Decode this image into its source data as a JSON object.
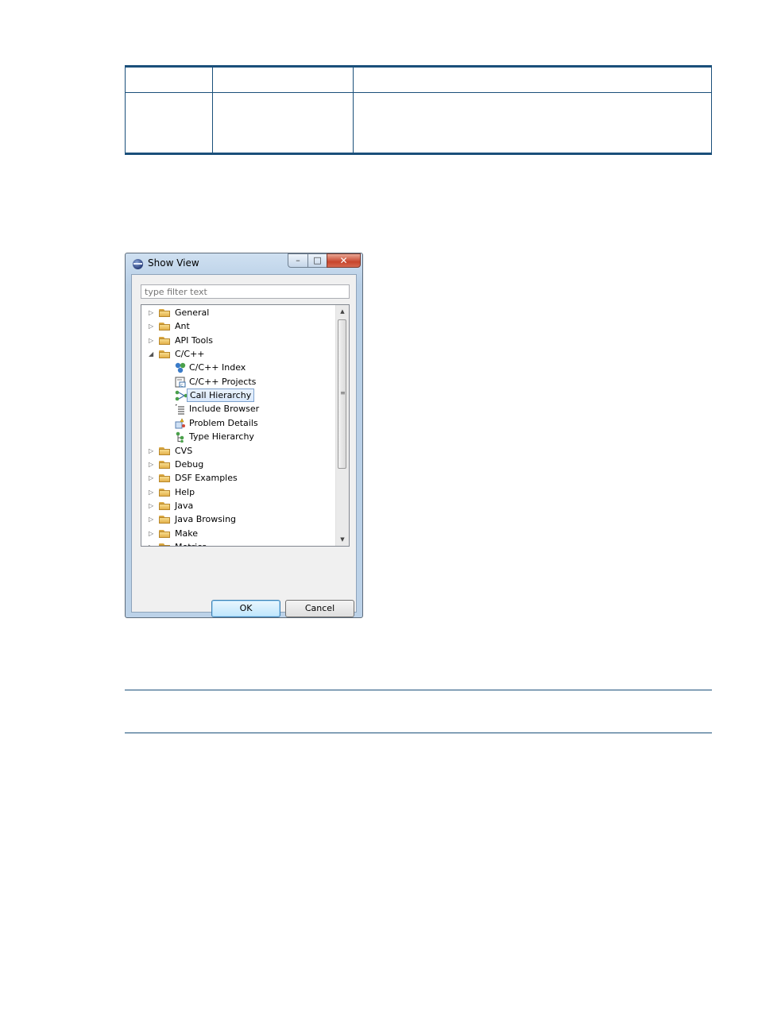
{
  "dialog": {
    "title": "Show View",
    "filter_placeholder": "type filter text",
    "ok_label": "OK",
    "cancel_label": "Cancel"
  },
  "window_buttons": {
    "minimize": "–",
    "maximize": "□",
    "close": "✕"
  },
  "tree": {
    "items": [
      {
        "label": "General",
        "expanded": false
      },
      {
        "label": "Ant",
        "expanded": false
      },
      {
        "label": "API Tools",
        "expanded": false
      },
      {
        "label": "C/C++",
        "expanded": true
      },
      {
        "label": "C/C++ Index",
        "child": true,
        "icon": "cpp-index-icon"
      },
      {
        "label": "C/C++ Projects",
        "child": true,
        "icon": "cpp-projects-icon"
      },
      {
        "label": "Call Hierarchy",
        "child": true,
        "icon": "call-hierarchy-icon",
        "selected": true
      },
      {
        "label": "Include Browser",
        "child": true,
        "icon": "include-browser-icon"
      },
      {
        "label": "Problem Details",
        "child": true,
        "icon": "problem-details-icon"
      },
      {
        "label": "Type Hierarchy",
        "child": true,
        "icon": "type-hierarchy-icon"
      },
      {
        "label": "CVS",
        "expanded": false
      },
      {
        "label": "Debug",
        "expanded": false
      },
      {
        "label": "DSF Examples",
        "expanded": false
      },
      {
        "label": "Help",
        "expanded": false
      },
      {
        "label": "Java",
        "expanded": false
      },
      {
        "label": "Java Browsing",
        "expanded": false
      },
      {
        "label": "Make",
        "expanded": false
      },
      {
        "label": "Metrics",
        "expanded": false
      }
    ]
  },
  "colors": {
    "rule": "#1a4f7a",
    "selection_border": "#7da2ce"
  }
}
